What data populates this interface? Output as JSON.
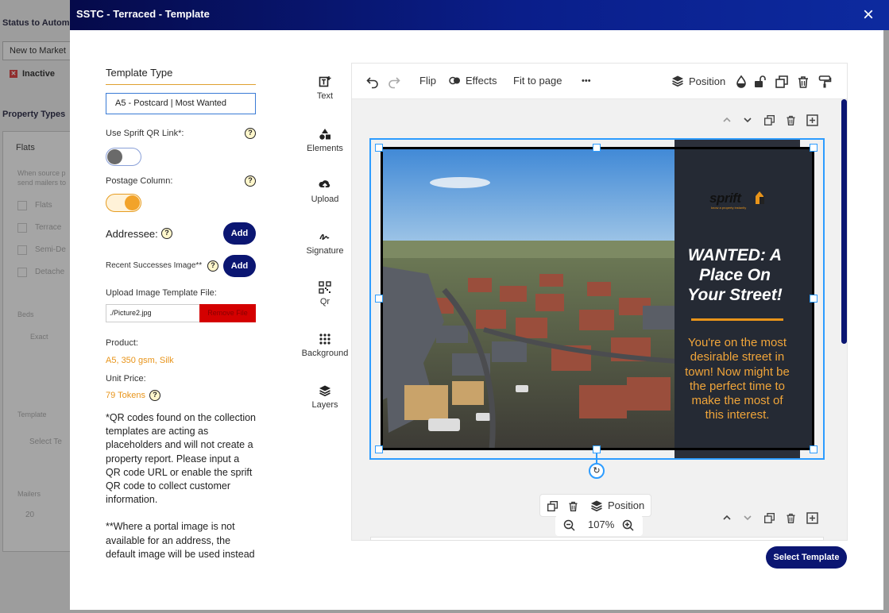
{
  "background": {
    "status_title": "Status to Autom",
    "select_value": "New to Market",
    "inactive_label": "Inactive",
    "property_types_title": "Property Types",
    "flats_tab": "Flats",
    "hint_line1": "When source p",
    "hint_line2": "send mailers to",
    "options": [
      "Flats",
      "Terrace",
      "Semi-De",
      "Detache"
    ],
    "beds_label": "Beds",
    "exact_label": "Exact",
    "template_label": "Template",
    "template_select": "Select Te",
    "mailers_label": "Mailers",
    "mailers_value": "20"
  },
  "modal": {
    "title": "SSTC - Terraced - Template",
    "close_label": "×"
  },
  "settings": {
    "template_type_label": "Template Type",
    "template_type_value": "A5 - Postcard | Most Wanted",
    "qr_link_label": "Use Sprift QR Link*:",
    "qr_link_on": false,
    "postage_label": "Postage Column:",
    "postage_on": true,
    "addressee_label": "Addressee:",
    "add_label": "Add",
    "recent_label": "Recent Successes Image**",
    "upload_label": "Upload Image Template File:",
    "file_value": "./Picture2.jpg",
    "remove_label": "Remove File",
    "product_label": "Product:",
    "product_value": "A5, 350 gsm, Silk",
    "unit_price_label": "Unit Price:",
    "unit_price_value": "79 Tokens",
    "help_glyph": "?",
    "note1": "*QR codes found on the collection templates are acting as placeholders and will not create a property report. Please input a QR code URL or enable the sprift QR code to collect customer information.",
    "note2": "**Where a portal image is not available for an address, the default image will be used instead"
  },
  "rail": [
    "Text",
    "Elements",
    "Upload",
    "Signature",
    "Qr",
    "Background",
    "Layers"
  ],
  "toolbar": {
    "flip": "Flip",
    "effects": "Effects",
    "fit": "Fit to page",
    "more": "•••",
    "position": "Position"
  },
  "postcard": {
    "logo": "sprift",
    "logo_sub": "know a property instantly",
    "headline": "WANTED: A Place On Your Street!",
    "body": "You're on the most desirable street in town! Now might be the perfect time to make the most of this interest.",
    "accent_color": "#e8941a"
  },
  "float_bar": {
    "position": "Position"
  },
  "zoom": {
    "value": "107%"
  },
  "footer": {
    "select_template": "Select Template"
  },
  "colors": {
    "brand_navy": "#0b1672",
    "selection_blue": "#2d9cff",
    "orange": "#e8941a"
  }
}
